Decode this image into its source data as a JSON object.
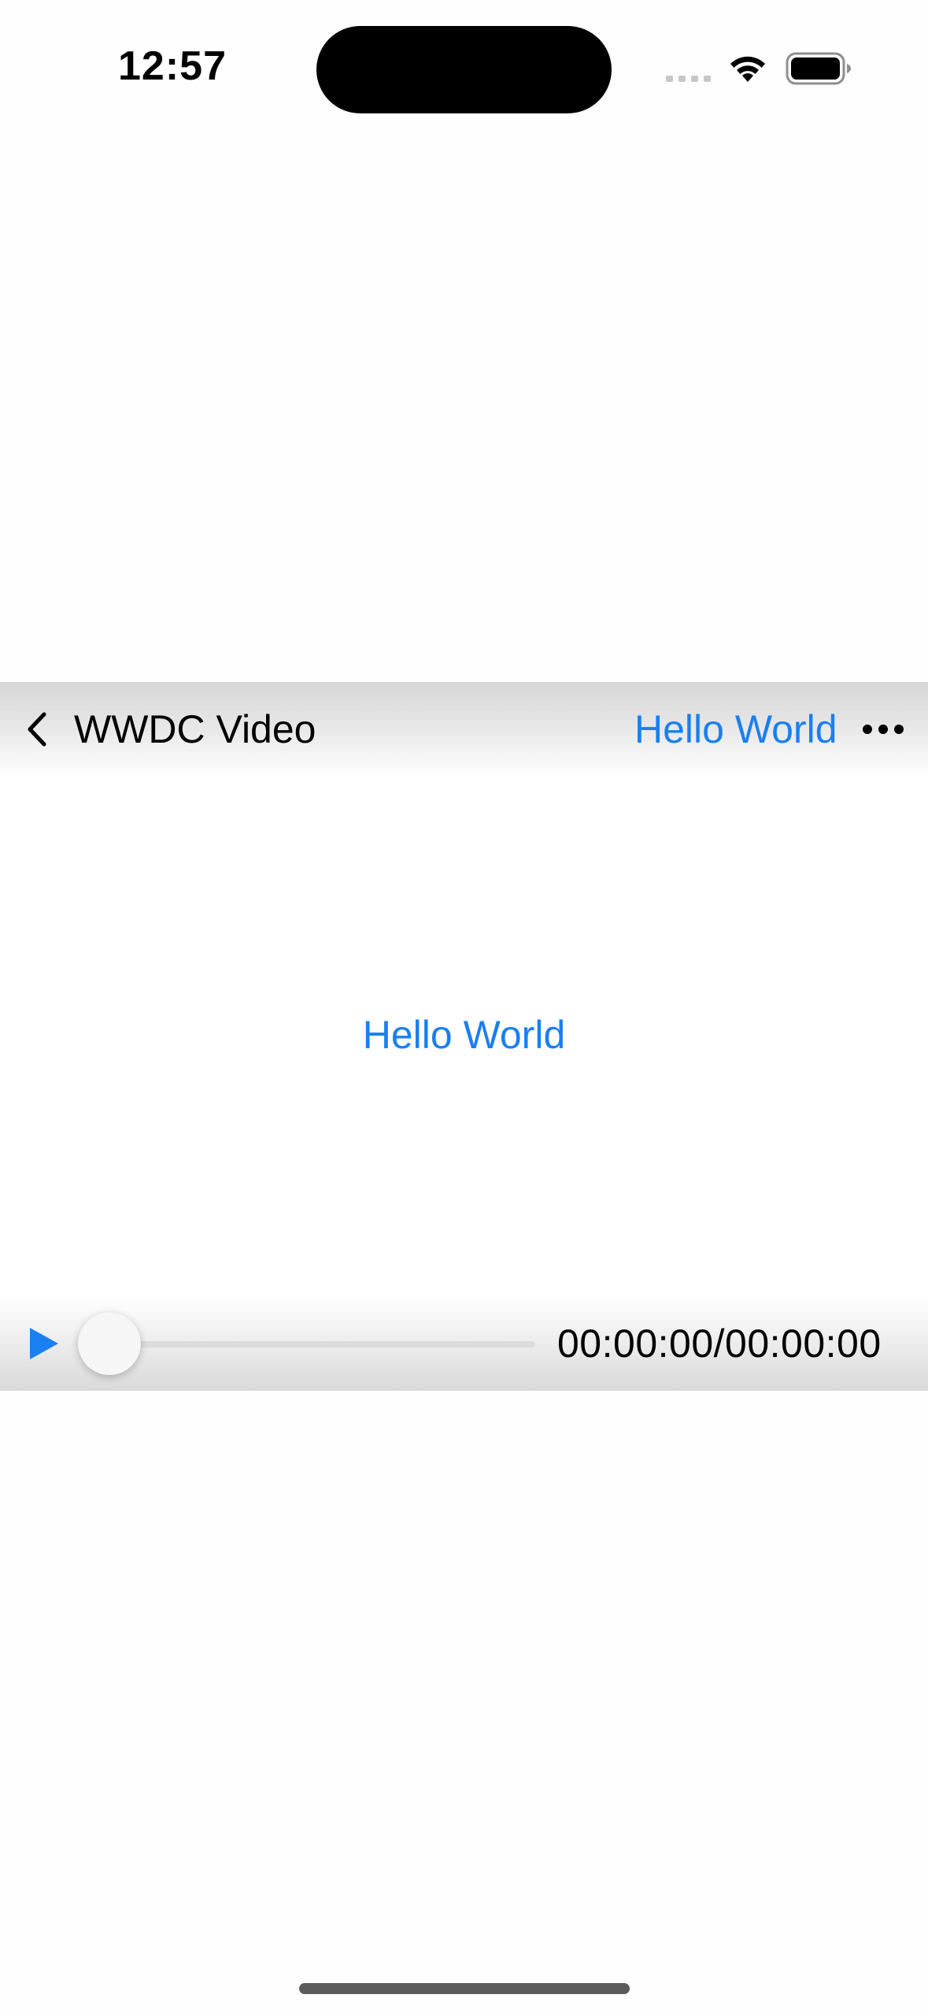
{
  "status_bar": {
    "time": "12:57",
    "icons": [
      "signal-dots-icon",
      "wifi-icon",
      "battery-icon"
    ]
  },
  "player": {
    "top_bar": {
      "back_icon": "chevron-left-icon",
      "title": "WWDC Video",
      "right_link": "Hello World",
      "more_icon": "ellipsis-icon"
    },
    "center_label": "Hello World",
    "controls": {
      "play_icon": "play-icon",
      "progress": 0,
      "time_readout": "00:00:00/00:00:00"
    }
  },
  "colors": {
    "accent": "#1a7ff0",
    "text": "#000000",
    "background": "#fefefe"
  }
}
